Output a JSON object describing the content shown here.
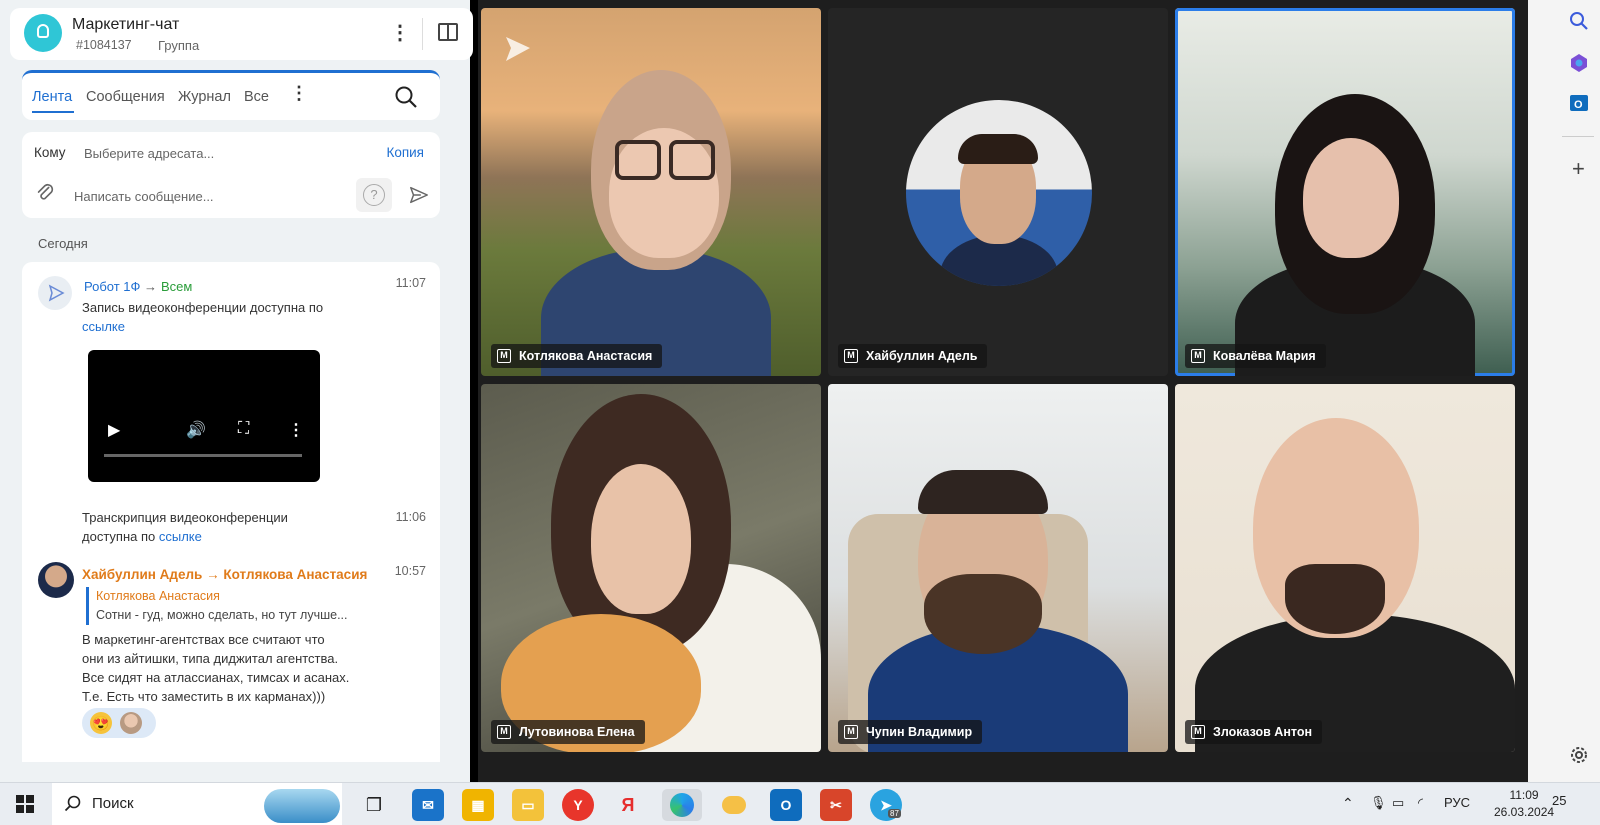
{
  "chat": {
    "title": "Маркетинг-чат",
    "id": "#1084137",
    "type": "Группа",
    "tabs": [
      "Лента",
      "Сообщения",
      "Журнал",
      "Все"
    ],
    "to_label": "Кому",
    "to_placeholder": "Выберите адресата...",
    "copy_label": "Копия",
    "message_placeholder": "Написать сообщение...",
    "help_label": "?",
    "date_separator": "Сегодня"
  },
  "messages": [
    {
      "author": "Робот 1Ф",
      "arrow": "→",
      "recipient": "Всем",
      "time": "11:07",
      "text_line1": "Запись видеоконференции доступна по",
      "link": "ссылке"
    },
    {
      "text_line1": "Транскрипция видеоконференции",
      "text_prefix": "доступна по",
      "link": "ссылке",
      "time": "11:06"
    },
    {
      "author": "Хайбуллин Адель",
      "arrow": "→",
      "recipient": "Котлякова Анастасия",
      "time": "10:57",
      "quote_author": "Котлякова Анастасия",
      "quote_text": "Сотни - гуд, можно сделать, но тут лучше...",
      "lines": [
        "В маркетинг-агентствах все считают что",
        "они из айтишки, типа диджитал агентства.",
        "Все сидят на атлассианах, тимсах и асанах.",
        "Т.е. Есть что заместить в их карманах)))"
      ],
      "reaction_emoji": "😍"
    }
  ],
  "participants": [
    {
      "name": "Котлякова Анастасия",
      "badge": "M"
    },
    {
      "name": "Хайбуллин Адель",
      "badge": "M"
    },
    {
      "name": "Ковалёва Мария",
      "badge": "M"
    },
    {
      "name": "Лутовинова Елена",
      "badge": "M"
    },
    {
      "name": "Чупин Владимир",
      "badge": "M"
    },
    {
      "name": "Злоказов Антон",
      "badge": "M"
    }
  ],
  "taskbar": {
    "search_label": "Поиск",
    "apps": [
      "Y",
      "Я"
    ],
    "telegram_badge": "87",
    "lang": "РУС",
    "time": "11:09",
    "date": "26.03.2024",
    "notifications": "25"
  },
  "colors": {
    "accent": "#1f6fd1",
    "author_orange": "#e07b1a",
    "recipient_green": "#2a9d3a",
    "highlight_border": "#2b7de9"
  }
}
